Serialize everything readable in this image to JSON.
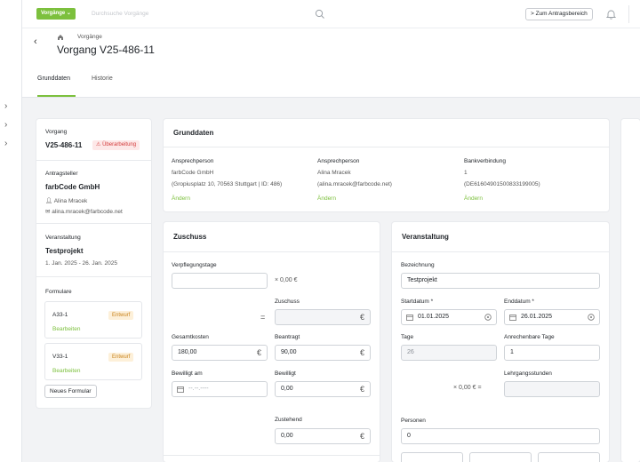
{
  "topbar": {
    "dropdown_label": "Vorgänge",
    "search_placeholder": "Durchsuche Vorgänge",
    "antrag_button": "> Zum Antragsbereich"
  },
  "header": {
    "breadcrumb": "Vorgänge",
    "title": "Vorgang V25-486-11"
  },
  "tabs": [
    {
      "label": "Grunddaten",
      "active": true
    },
    {
      "label": "Historie",
      "active": false
    }
  ],
  "sidebar": {
    "vorgang_label": "Vorgang",
    "vorgang_id": "V25-486-11",
    "status_badge": "Überarbeitung",
    "antragsteller_label": "Antragsteller",
    "company": "farbCode GmbH",
    "person": "Alina Mracek",
    "email": "alina.mracek@farbcode.net",
    "veranstaltung_label": "Veranstaltung",
    "projekt": "Testprojekt",
    "zeitraum": "1. Jan. 2025 - 26. Jan. 2025",
    "formulare_label": "Formulare",
    "forms": [
      {
        "name": "A33-1",
        "status": "Entwurf",
        "action": "Bearbeiten"
      },
      {
        "name": "V33-1",
        "status": "Entwurf",
        "action": "Bearbeiten"
      }
    ],
    "new_form_button": "Neues Formular"
  },
  "grunddaten": {
    "title": "Grunddaten",
    "columns": [
      {
        "label": "Ansprechperson",
        "line1": "farbCode GmbH",
        "line2": "(Gropiusplatz 10, 70563 Stuttgart | ID: 486)",
        "action": "Ändern"
      },
      {
        "label": "Ansprechperson",
        "line1": "Alina Mracek",
        "line2": "(alina.mracek@farbcode.net)",
        "action": "Ändern"
      },
      {
        "label": "Bankverbindung",
        "line1": "1",
        "line2": "(DE61604901500833199005)",
        "action": "Ändern"
      }
    ]
  },
  "zuschuss": {
    "title": "Zuschuss",
    "verpflegungstage_label": "Verpflegungstage",
    "verpflegungstage_value": "",
    "times_amount": "× 0,00 €",
    "zuschuss_label": "Zuschuss",
    "zuschuss_value": "",
    "equals": "=",
    "gesamtkosten_label": "Gesamtkosten",
    "gesamtkosten_value": "180,00",
    "beantragt_label": "Beantragt",
    "beantragt_value": "90,00",
    "bewilligt_am_label": "Bewilligt am",
    "bewilligt_am_placeholder": "--.--.----",
    "bewilligt_label": "Bewilligt",
    "bewilligt_value": "0,00",
    "zustehend_label": "Zustehend",
    "zustehend_value": "0,00",
    "currency": "€"
  },
  "veranstaltung": {
    "title": "Veranstaltung",
    "bezeichnung_label": "Bezeichnung",
    "bezeichnung_value": "Testprojekt",
    "startdatum_label": "Startdatum *",
    "startdatum_value": "01.01.2025",
    "enddatum_label": "Enddatum *",
    "enddatum_value": "26.01.2025",
    "tage_label": "Tage",
    "tage_value": "26",
    "anrechenbare_label": "Anrechenbare Tage",
    "anrechenbare_value": "1",
    "lehrgang_label": "Lehrgangsstunden",
    "lehrgang_calc": "× 0,00 € =",
    "lehrgang_value": "",
    "personen_label": "Personen",
    "personen_value": "0"
  },
  "colors": {
    "accent": "#7cc03d",
    "badge_red": "#d33b3b",
    "badge_orange": "#c8821b"
  }
}
